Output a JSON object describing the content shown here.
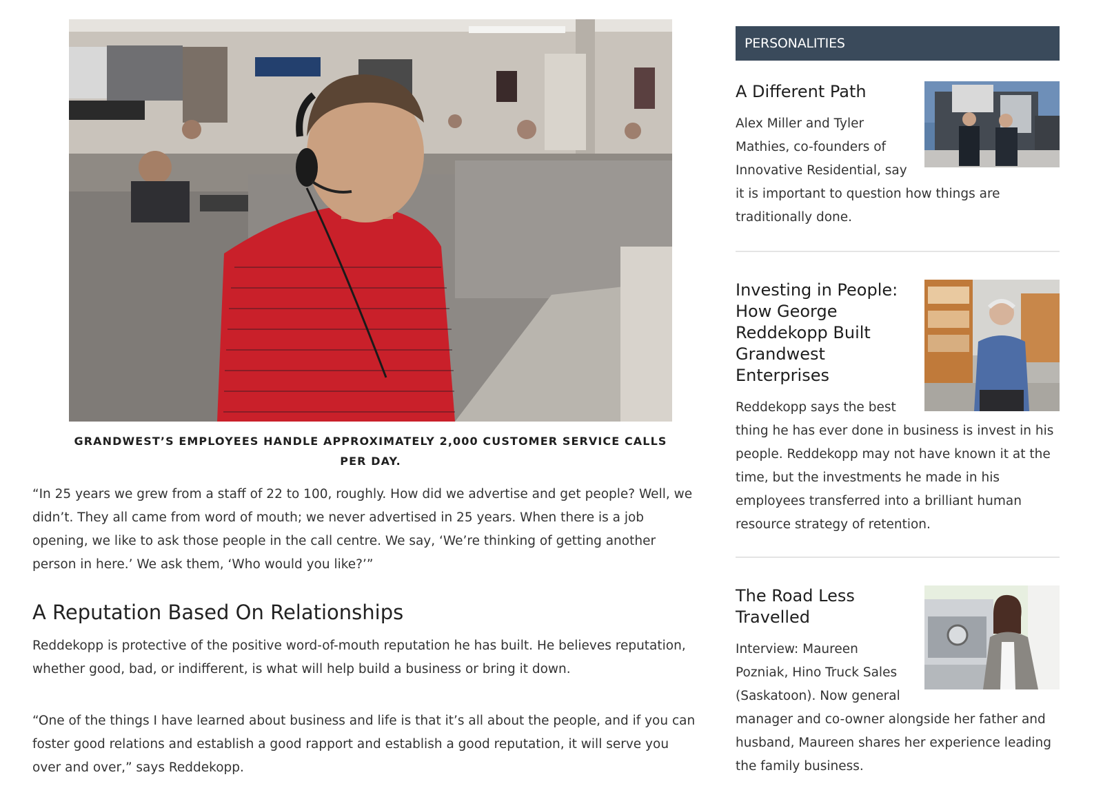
{
  "article": {
    "caption": "Grandwest’s employees handle approximately 2,000 customer service calls per day.",
    "paragraph1": "“In 25 years we grew from a staff of 22 to 100, roughly. How did we advertise and get people? Well, we didn’t. They all came from word of mouth; we never advertised in 25 years. When there is a job opening, we like to ask those people in the call centre. We say, ‘We’re thinking of getting another person in here.’ We ask them, ‘Who would you like?’”",
    "heading": "A Reputation Based On Relationships",
    "paragraph2": "Reddekopp is protective of the positive word-of-mouth reputation he has built. He believes reputation, whether good, bad, or indifferent, is what will help build a business or bring it down.",
    "paragraph3": "“One of the things I have learned about business and life is that it’s all about the people, and if you can foster good relations and establish a good rapport and establish a good reputation, it will serve you over and over,” says Reddekopp."
  },
  "sidebar": {
    "header": "PERSONALITIES",
    "cards": [
      {
        "title": "A Different Path",
        "text": "Alex Miller and Tyler Mathies, co-founders of Innovative Residential, say it is important to question how things are traditionally done."
      },
      {
        "title": "Investing in People: How George Reddekopp Built Grandwest Enterprises",
        "text": "Reddekopp says the best thing he has ever done in business is invest in his people. Reddekopp may not have known it at the time, but the investments he made in his employees transferred into a brilliant human resource strategy of retention."
      },
      {
        "title": "The Road Less Travelled",
        "text": "Interview: Maureen Pozniak, Hino Truck Sales (Saskatoon). Now general manager and co-owner alongside her father and husband, Maureen shares her experience leading the family business."
      }
    ]
  }
}
